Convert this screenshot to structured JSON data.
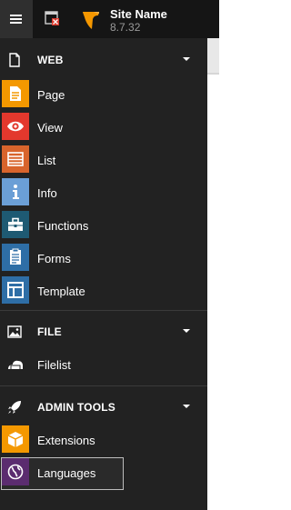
{
  "topbar": {
    "menu_toggle_icon": "hamburger-icon",
    "clear_cache_icon": "clear-cache-icon",
    "site_name": "Site Name",
    "site_version": "8.7.32",
    "logo_icon": "typo3-logo-icon"
  },
  "colors": {
    "topbar_bg": "#151515",
    "menu_bg": "#222222",
    "brand_orange": "#f49700",
    "page": "#f49800",
    "view": "#e3382d",
    "list": "#d8642c",
    "info": "#6b9fd6",
    "functions": "#1e5a73",
    "forms": "#2e6ea6",
    "template": "#2e6ea6",
    "filelist": "#222222",
    "extensions": "#f49800",
    "languages": "#5b2c6f"
  },
  "groups": [
    {
      "icon": "page-icon",
      "label": "WEB",
      "modules": [
        {
          "label": "Page",
          "icon": "page-icon"
        },
        {
          "label": "View",
          "icon": "eye-icon"
        },
        {
          "label": "List",
          "icon": "list-icon"
        },
        {
          "label": "Info",
          "icon": "info-icon"
        },
        {
          "label": "Functions",
          "icon": "toolbox-icon"
        },
        {
          "label": "Forms",
          "icon": "forms-icon"
        },
        {
          "label": "Template",
          "icon": "template-icon"
        }
      ]
    },
    {
      "icon": "image-icon",
      "label": "FILE",
      "modules": [
        {
          "label": "Filelist",
          "icon": "folder-icon"
        }
      ]
    },
    {
      "icon": "rocket-icon",
      "label": "ADMIN TOOLS",
      "modules": [
        {
          "label": "Extensions",
          "icon": "box-icon"
        },
        {
          "label": "Languages",
          "icon": "globe-icon"
        }
      ]
    }
  ]
}
